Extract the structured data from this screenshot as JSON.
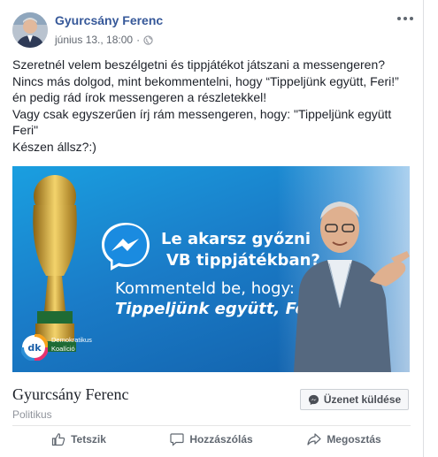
{
  "header": {
    "author": "Gyurcsány Ferenc",
    "date": "június 13., 18:00",
    "separator": "·",
    "privacy_icon": "globe-icon",
    "menu_icon": "more-dots-icon"
  },
  "post_text": {
    "line1": "Szeretnél velem beszélgetni és tippjátékot játszani a messengeren?",
    "line2": "Nincs más dolgod, mint bekommentelni, hogy “Tippeljünk együtt, Feri!” én pedig rád írok messengeren a részletekkel!",
    "line3": "Vagy csak egyszerűen írj rám messengeren, hogy: \"Tippeljünk együtt Feri\"",
    "line4": "Készen állsz?:)"
  },
  "banner": {
    "headline_line1": "Le akarsz győzni",
    "headline_line2": "VB tippjátékban?",
    "sub_line1": "Kommenteld be, hogy:",
    "sub_line2": "Tippeljünk együtt, Feri!",
    "logo_letters": "dk",
    "logo_text_line1": "Demokratikus",
    "logo_text_line2": "Koalíció",
    "colors": {
      "background": "#1a7cc8",
      "text": "#ffffff"
    }
  },
  "page_footer": {
    "page_name": "Gyurcsány Ferenc",
    "category": "Politikus",
    "message_button": "Üzenet küldése"
  },
  "actions": {
    "like": "Tetszik",
    "comment": "Hozzászólás",
    "share": "Megosztás"
  },
  "colors": {
    "link": "#365899",
    "muted": "#90949c",
    "action": "#606770"
  }
}
